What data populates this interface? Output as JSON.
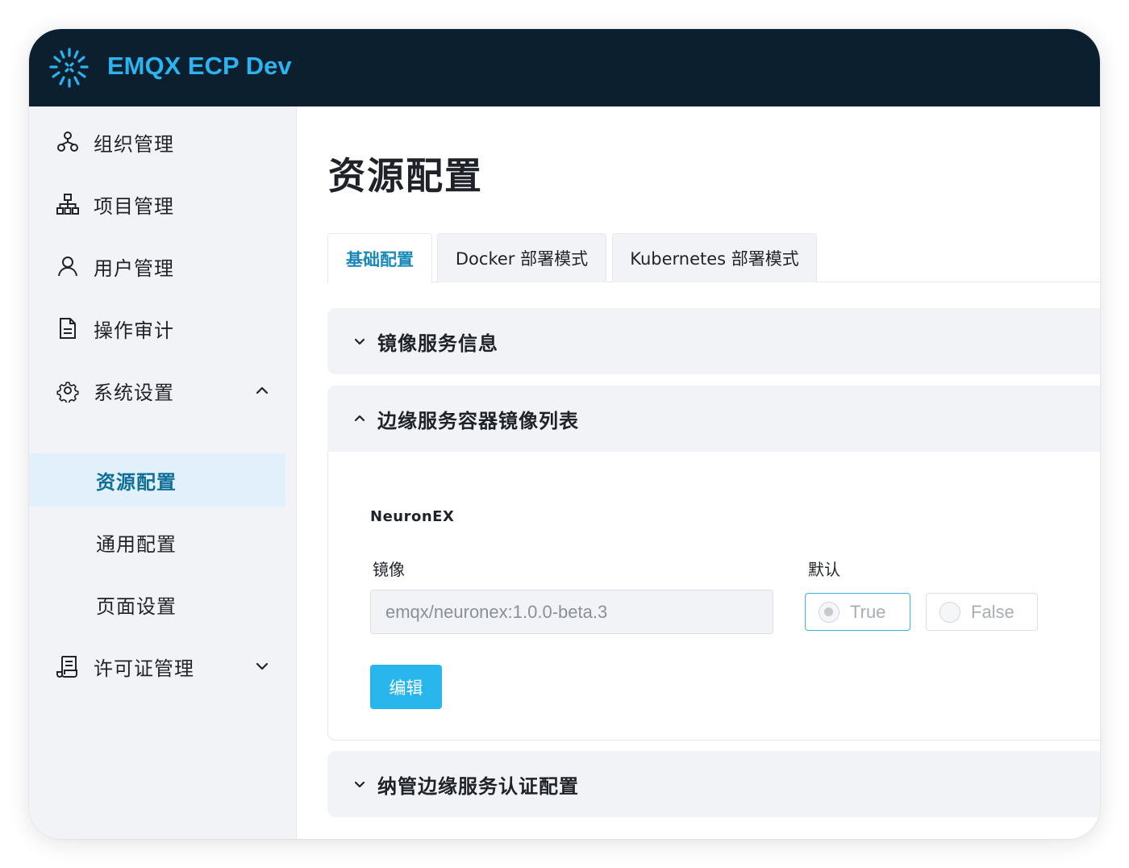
{
  "app": {
    "title": "EMQX ECP Dev",
    "logo_icon": "burst-logo-icon",
    "brand_color": "#2bb4ef",
    "header_bg": "#0b1f2e"
  },
  "sidebar": {
    "items": [
      {
        "label": "组织管理",
        "icon": "organization-icon"
      },
      {
        "label": "项目管理",
        "icon": "hierarchy-icon"
      },
      {
        "label": "用户管理",
        "icon": "user-icon"
      },
      {
        "label": "操作审计",
        "icon": "document-icon"
      },
      {
        "label": "系统设置",
        "icon": "gear-icon",
        "expanded": true,
        "children": [
          {
            "label": "资源配置",
            "active": true
          },
          {
            "label": "通用配置"
          },
          {
            "label": "页面设置"
          }
        ]
      },
      {
        "label": "许可证管理",
        "icon": "license-icon",
        "expanded": false
      }
    ]
  },
  "main": {
    "title": "资源配置",
    "tabs": [
      {
        "label": "基础配置",
        "active": true
      },
      {
        "label": "Docker 部署模式"
      },
      {
        "label": "Kubernetes 部署模式"
      }
    ],
    "panels": [
      {
        "title": "镜像服务信息",
        "expanded": false
      },
      {
        "title": "边缘服务容器镜像列表",
        "expanded": true
      },
      {
        "title": "纳管边缘服务认证配置",
        "expanded": false
      }
    ],
    "image_list": {
      "name": "NeuronEX",
      "image_label": "镜像",
      "image_value": "emqx/neuronex:1.0.0-beta.3",
      "default_label": "默认",
      "options": [
        {
          "label": "True",
          "selected": true
        },
        {
          "label": "False",
          "selected": false
        }
      ],
      "edit_label": "编辑"
    }
  }
}
